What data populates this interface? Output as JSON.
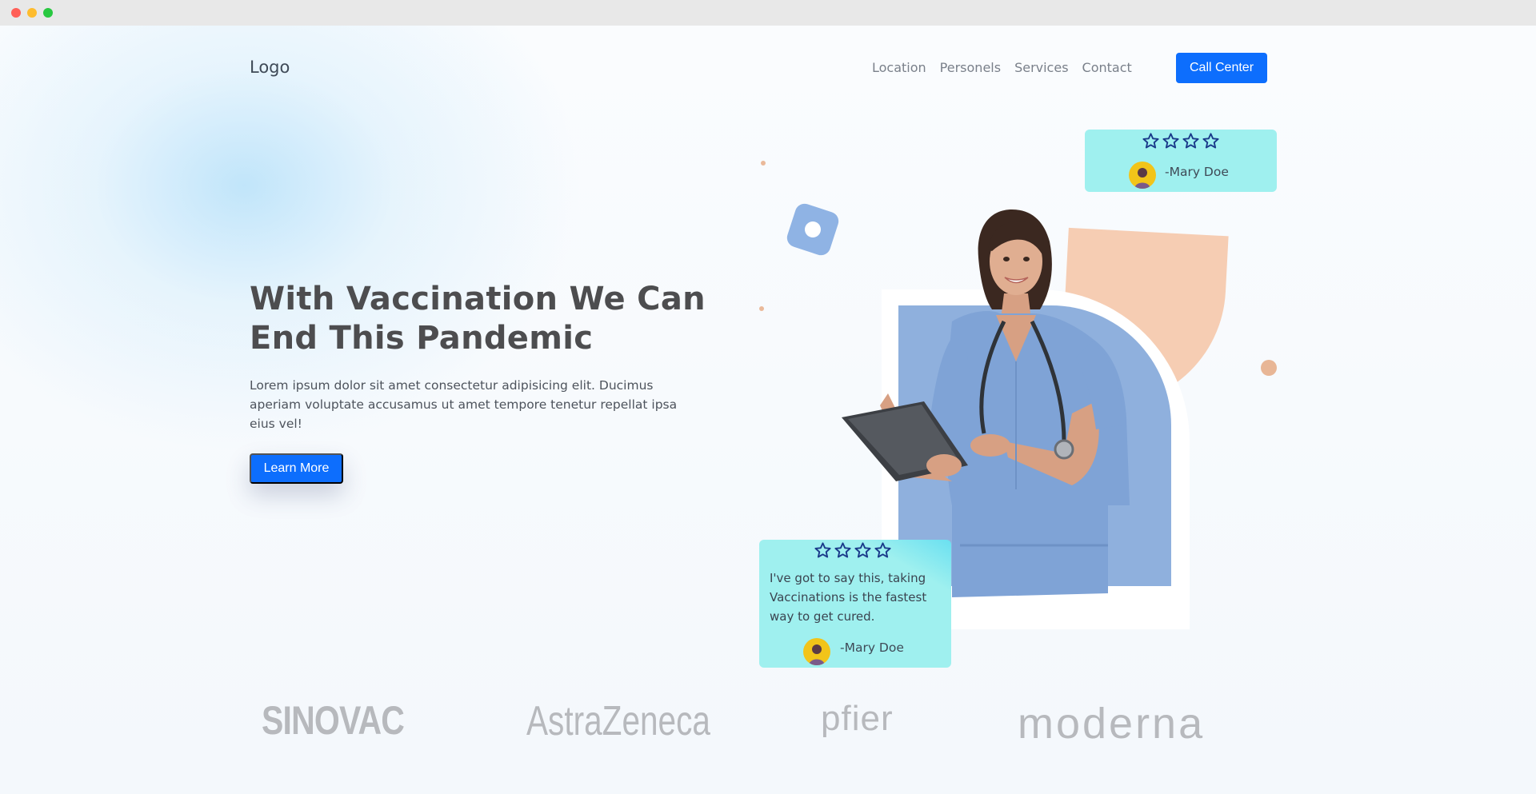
{
  "header": {
    "logo": "Logo",
    "nav": [
      "Location",
      "Personels",
      "Services",
      "Contact"
    ],
    "call_button": "Call Center"
  },
  "hero": {
    "headline_line1": "With Vaccination We Can",
    "headline_line2": "End This Pandemic",
    "paragraph": "Lorem ipsum dolor sit amet consectetur adipisicing elit. Ducimus aperiam voluptate accusamus ut amet tempore tenetur repellat ipsa eius vel!",
    "button": "Learn More"
  },
  "reviews": [
    {
      "stars": 4,
      "author": "-Mary Doe"
    },
    {
      "stars": 4,
      "text": "I've got to say this, taking Vaccinations is the fastest way to get cured.",
      "author": "-Mary Doe"
    }
  ],
  "brands": [
    "SINOVAC",
    "AstraZeneca",
    "pfier",
    "moderna"
  ],
  "colors": {
    "primary": "#0d6efd",
    "card": "#9ff0ef",
    "photo_bg": "#8fb0dd",
    "peach": "#f6cdb3",
    "star": "#1a3a8a"
  }
}
